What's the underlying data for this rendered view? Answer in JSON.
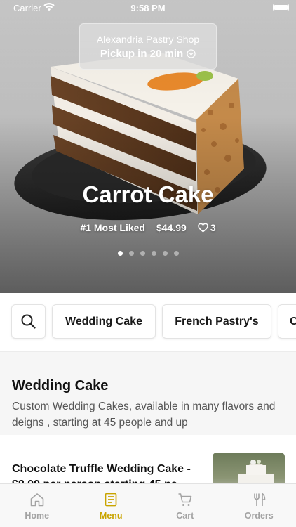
{
  "status_bar": {
    "carrier": "Carrier",
    "time": "9:58 PM"
  },
  "store": {
    "name": "Alexandria Pastry Shop",
    "pickup": "Pickup in 20 min"
  },
  "hero": {
    "title": "Carrot Cake",
    "tag": "#1 Most Liked",
    "price": "$44.99",
    "likes": "3",
    "slides": 6,
    "active_slide": 0
  },
  "categories": {
    "search_icon": "search-icon",
    "items": [
      "Wedding Cake",
      "French Pastry's",
      "C"
    ]
  },
  "section": {
    "title": "Wedding Cake",
    "description": "Custom Wedding Cakes, available in many flavors and deigns , starting at 45 people  and up"
  },
  "menu_item": {
    "name": "Chocolate Truffle Wedding Cake - $8.99 per person starting 45 pe"
  },
  "tab_bar": {
    "tabs": [
      {
        "label": "Home",
        "icon": "home-icon"
      },
      {
        "label": "Menu",
        "icon": "menu-icon"
      },
      {
        "label": "Cart",
        "icon": "cart-icon"
      },
      {
        "label": "Orders",
        "icon": "utensils-icon"
      }
    ],
    "active": "Menu"
  },
  "colors": {
    "accent": "#c9a400",
    "inactive": "#a3a3a3"
  }
}
